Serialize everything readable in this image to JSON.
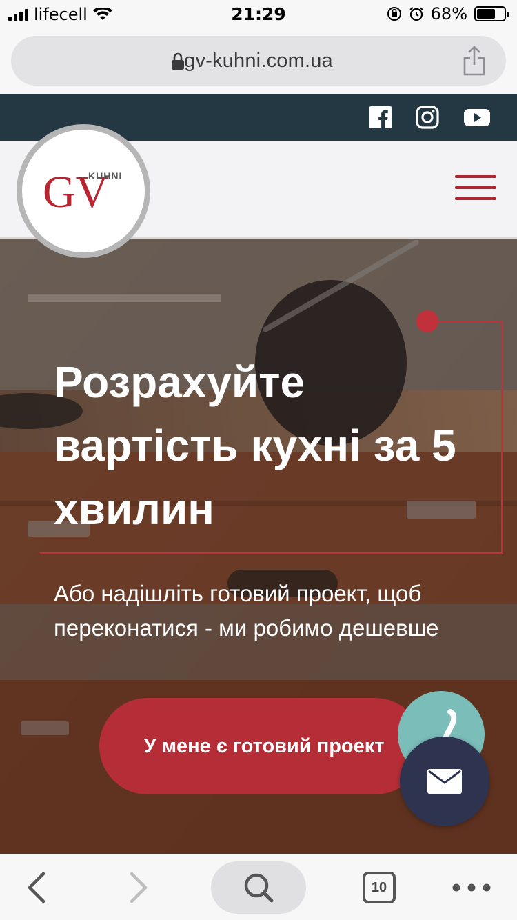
{
  "status": {
    "carrier": "lifecell",
    "time": "21:29",
    "battery_percent": "68%",
    "battery_level": 0.68
  },
  "browser": {
    "url": "gv-kuhni.com.ua",
    "tab_count": "10"
  },
  "social": {
    "icons": [
      "facebook-icon",
      "instagram-icon",
      "youtube-icon"
    ]
  },
  "logo": {
    "letters": "GV",
    "word": "KUHNI"
  },
  "hero": {
    "title": "Розрахуйте вартість кухні за 5 хвилин",
    "subtitle": "Або надішліть готовий проект, щоб переконатися - ми робимо дешевше",
    "cta_label": "У мене є готовий проект"
  },
  "colors": {
    "brand_red": "#b52e37",
    "social_bar": "#233843",
    "mail_button": "#2e3350",
    "phone_button": "#7bbdb9"
  }
}
